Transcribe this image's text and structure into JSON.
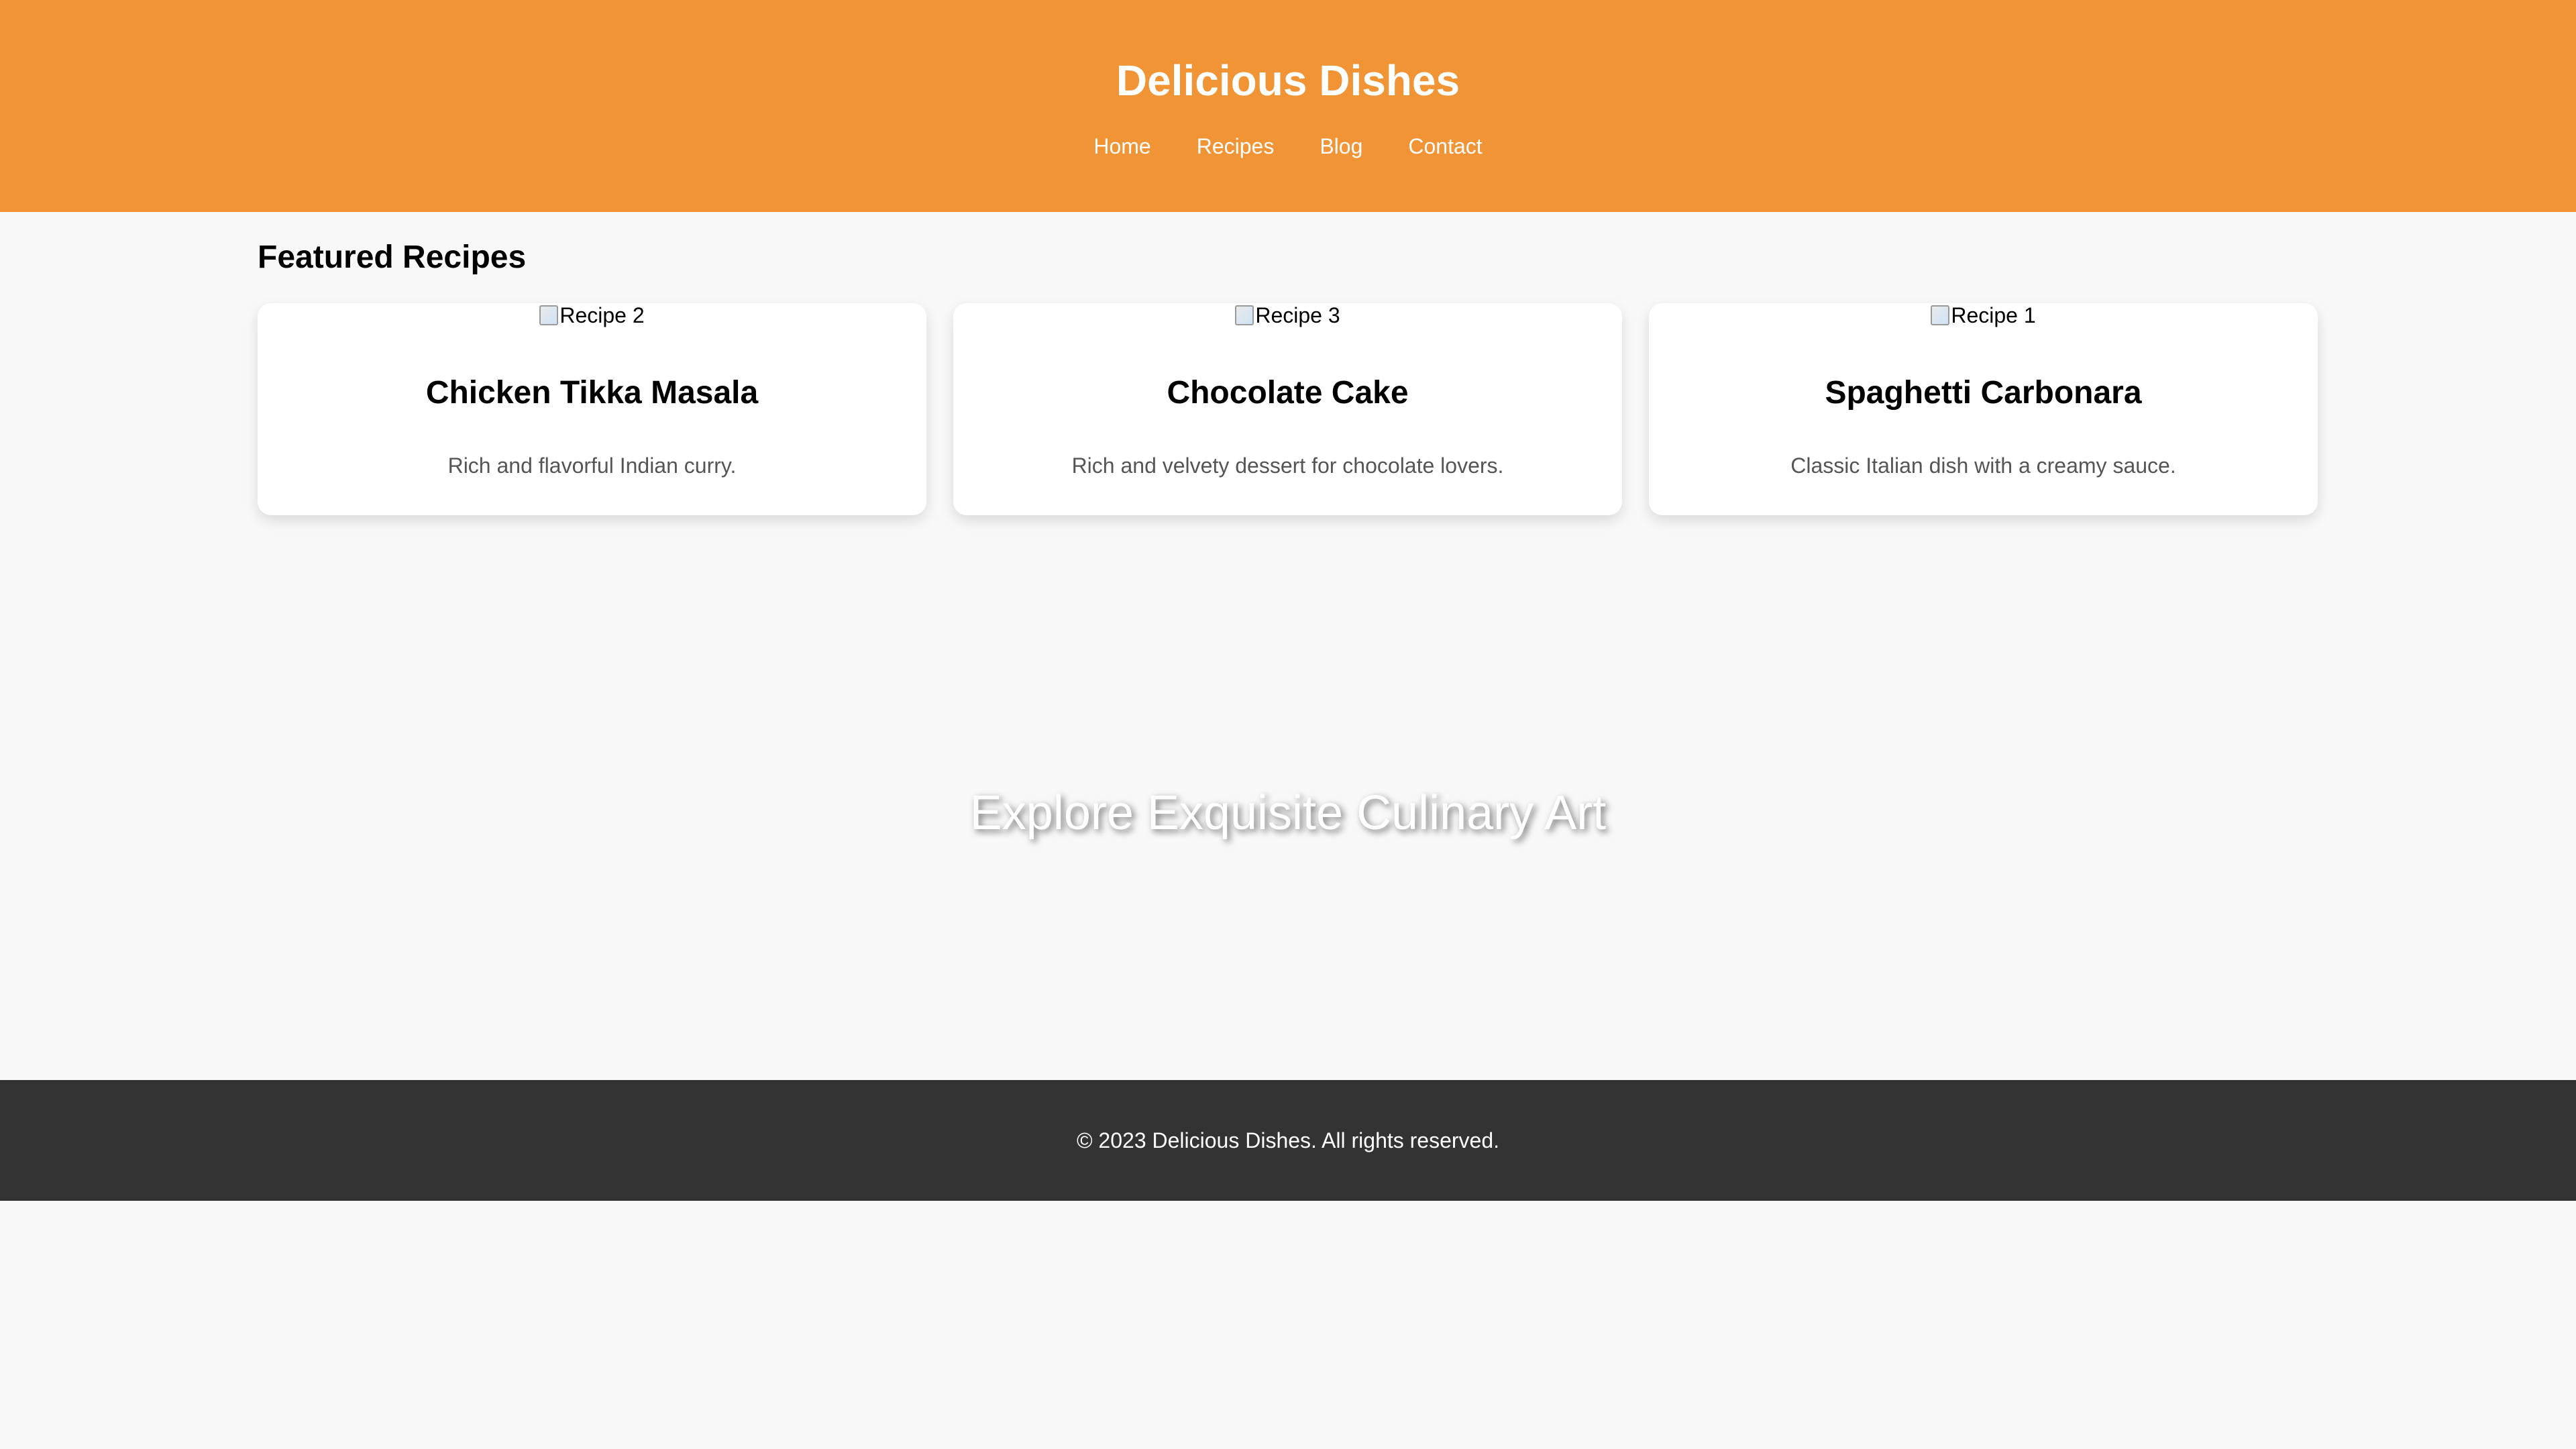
{
  "header": {
    "title": "Delicious Dishes",
    "nav": [
      {
        "label": "Home"
      },
      {
        "label": "Recipes"
      },
      {
        "label": "Blog"
      },
      {
        "label": "Contact"
      }
    ]
  },
  "featured": {
    "title": "Featured Recipes",
    "cards": [
      {
        "image_alt": "Recipe 2",
        "title": "Chicken Tikka Masala",
        "description": "Rich and flavorful Indian curry."
      },
      {
        "image_alt": "Recipe 3",
        "title": "Chocolate Cake",
        "description": "Rich and velvety dessert for chocolate lovers."
      },
      {
        "image_alt": "Recipe 1",
        "title": "Spaghetti Carbonara",
        "description": "Classic Italian dish with a creamy sauce."
      }
    ]
  },
  "hero": {
    "text": "Explore Exquisite Culinary Art"
  },
  "footer": {
    "text": "© 2023 Delicious Dishes. All rights reserved."
  },
  "colors": {
    "header_bg": "#f09436",
    "page_bg": "#f8f8f8",
    "footer_bg": "#333333"
  }
}
